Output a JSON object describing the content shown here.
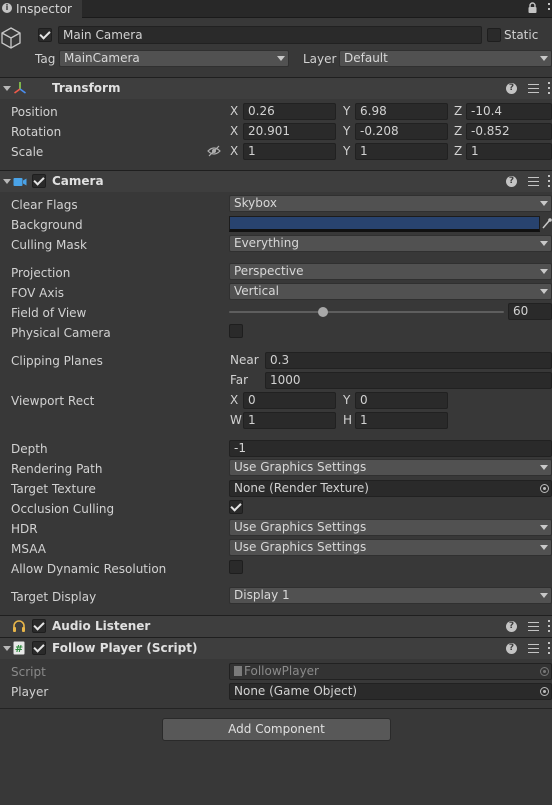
{
  "tab": {
    "title": "Inspector"
  },
  "gameobject": {
    "active": true,
    "name": "Main Camera",
    "static_label": "Static",
    "tag_label": "Tag",
    "tag_value": "MainCamera",
    "layer_label": "Layer",
    "layer_value": "Default"
  },
  "transform": {
    "title": "Transform",
    "position": {
      "label": "Position",
      "x": "0.26",
      "y": "6.98",
      "z": "-10.4"
    },
    "rotation": {
      "label": "Rotation",
      "x": "20.901",
      "y": "-0.208",
      "z": "-0.852"
    },
    "scale": {
      "label": "Scale",
      "x": "1",
      "y": "1",
      "z": "1"
    }
  },
  "axes": {
    "x": "X",
    "y": "Y",
    "z": "Z",
    "w": "W",
    "h": "H"
  },
  "camera": {
    "title": "Camera",
    "enabled": true,
    "clear_flags": {
      "label": "Clear Flags",
      "value": "Skybox"
    },
    "background": {
      "label": "Background",
      "color": "#28436f"
    },
    "culling_mask": {
      "label": "Culling Mask",
      "value": "Everything"
    },
    "projection": {
      "label": "Projection",
      "value": "Perspective"
    },
    "fov_axis": {
      "label": "FOV Axis",
      "value": "Vertical"
    },
    "field_of_view": {
      "label": "Field of View",
      "value": "60",
      "slider_min": 0,
      "slider_max": 180,
      "slider_position": 0.34
    },
    "physical_camera": {
      "label": "Physical Camera",
      "checked": false
    },
    "clipping_planes": {
      "label": "Clipping Planes",
      "near_label": "Near",
      "near": "0.3",
      "far_label": "Far",
      "far": "1000"
    },
    "viewport_rect": {
      "label": "Viewport Rect",
      "x": "0",
      "y": "0",
      "w": "1",
      "h": "1"
    },
    "depth": {
      "label": "Depth",
      "value": "-1"
    },
    "rendering_path": {
      "label": "Rendering Path",
      "value": "Use Graphics Settings"
    },
    "target_texture": {
      "label": "Target Texture",
      "value": "None (Render Texture)"
    },
    "occlusion_culling": {
      "label": "Occlusion Culling",
      "checked": true
    },
    "hdr": {
      "label": "HDR",
      "value": "Use Graphics Settings"
    },
    "msaa": {
      "label": "MSAA",
      "value": "Use Graphics Settings"
    },
    "dynamic_resolution": {
      "label": "Allow Dynamic Resolution",
      "checked": false
    },
    "target_display": {
      "label": "Target Display",
      "value": "Display 1"
    }
  },
  "audio_listener": {
    "title": "Audio Listener",
    "enabled": true
  },
  "follow_player": {
    "title": "Follow Player (Script)",
    "enabled": true,
    "script_label": "Script",
    "script_value": "FollowPlayer",
    "player_label": "Player",
    "player_value": "None (Game Object)"
  },
  "add_component": {
    "label": "Add Component"
  }
}
